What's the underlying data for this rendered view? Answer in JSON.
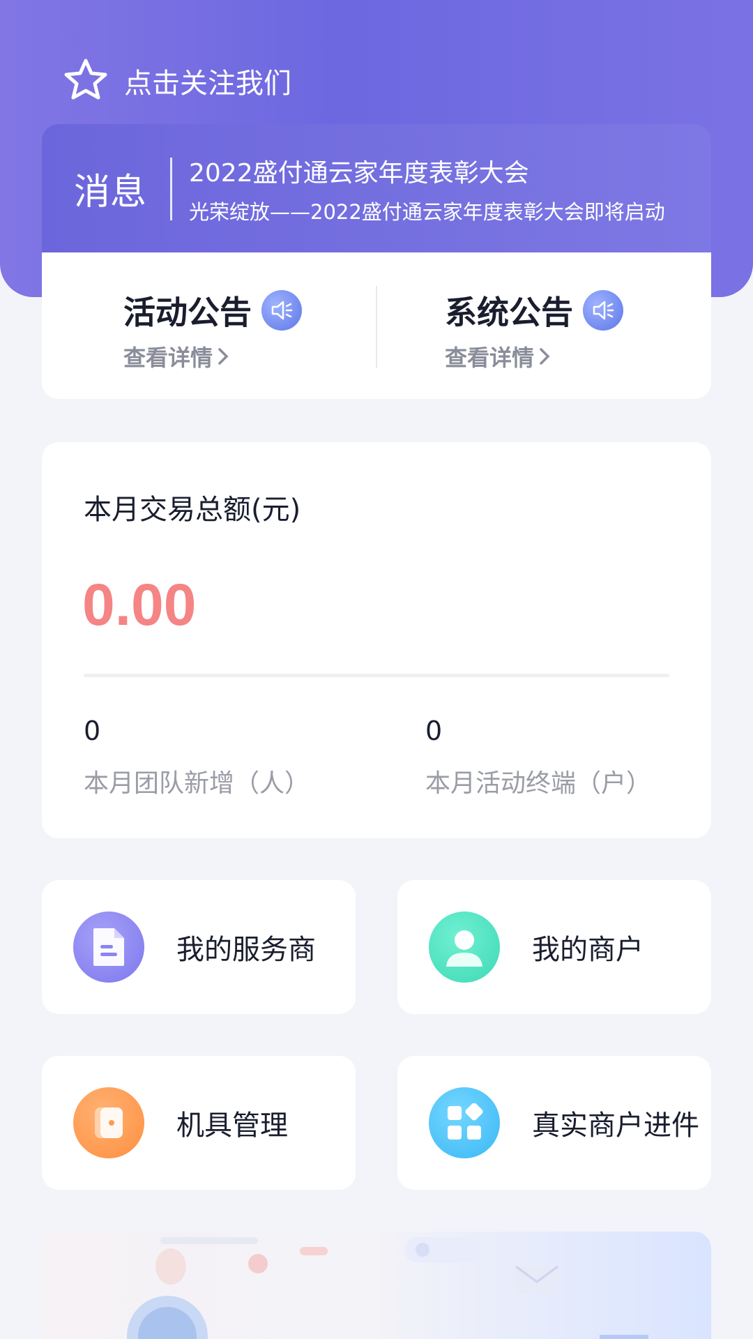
{
  "header": {
    "follow_label": "点击关注我们",
    "icon": "star-icon"
  },
  "message": {
    "label": "消息",
    "title": "2022盛付通云家年度表彰大会",
    "subtitle": "光荣绽放——2022盛付通云家年度表彰大会即将启动"
  },
  "notices": [
    {
      "title": "活动公告",
      "link": "查看详情",
      "icon": "speaker-icon"
    },
    {
      "title": "系统公告",
      "link": "查看详情",
      "icon": "speaker-icon"
    }
  ],
  "stats": {
    "label": "本月交易总额(元)",
    "amount": "0.00",
    "team_new_value": "0",
    "team_new_label": "本月团队新增（人）",
    "active_terminals_value": "0",
    "active_terminals_label": "本月活动终端（户）"
  },
  "tiles": [
    {
      "label": "我的服务商",
      "icon": "document-icon",
      "color": "#8a84f2"
    },
    {
      "label": "我的商户",
      "icon": "user-icon",
      "color": "#4fe3c3"
    },
    {
      "label": "机具管理",
      "icon": "wallet-icon",
      "color": "#ff9a52"
    },
    {
      "label": "真实商户进件",
      "icon": "grid-apps-icon",
      "color": "#4cc4f8"
    }
  ],
  "colors": {
    "header_gradient": "#6d68e0",
    "amount": "#f58484",
    "background": "#f2f4f9"
  }
}
